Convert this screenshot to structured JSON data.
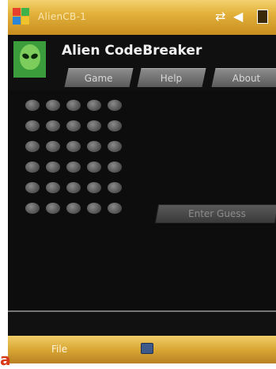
{
  "window": {
    "title": "AlienCB-1",
    "status_icons": [
      "connectivity-icon",
      "volume-icon",
      "battery-icon"
    ]
  },
  "header": {
    "app_name": "Alien CodeBreaker",
    "tabs": [
      {
        "label": "Game"
      },
      {
        "label": "Help"
      },
      {
        "label": "About"
      }
    ]
  },
  "board": {
    "rows": 6,
    "pegs_per_row": 5,
    "enter_guess_label": "Enter Guess"
  },
  "menubar": {
    "file_label": "File",
    "input_icon": "keyboard-icon"
  },
  "corner_mark": "a",
  "colors": {
    "title_gold": "#e2b13a",
    "background": "#111111",
    "peg_gray": "#5a5a5a",
    "avatar_green": "#3a9c3a"
  }
}
